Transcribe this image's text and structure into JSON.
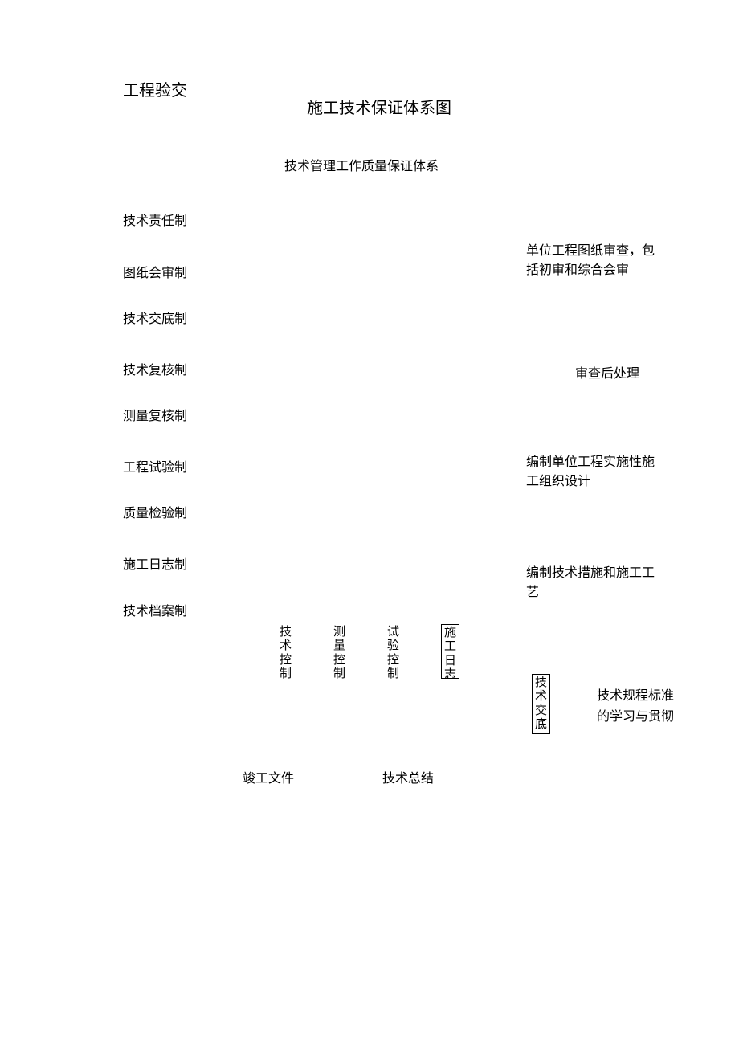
{
  "top_left": "工程验交",
  "title": "施工技术保证体系图",
  "subtitle": "技术管理工作质量保证体系",
  "left_items": [
    "技术责任制",
    "图纸会审制",
    "技术交底制",
    "技术复核制",
    "测量复核制",
    "工程试验制",
    "质量检验制",
    "施工日志制",
    "技术档案制"
  ],
  "right_items": [
    "单位工程图纸审查，包括初审和综合会审",
    "审查后处理",
    "编制单位工程实施性施工组织设计",
    "编制技术措施和施工工艺"
  ],
  "mid_boxes": [
    "技术控制",
    "测量控制",
    "试验控制",
    "施工日志"
  ],
  "bottom_right_box": "技术交底",
  "bottom_right_text": "技术规程标准的学习与贯彻",
  "bottom_labels": [
    "竣工文件",
    "技术总结"
  ]
}
